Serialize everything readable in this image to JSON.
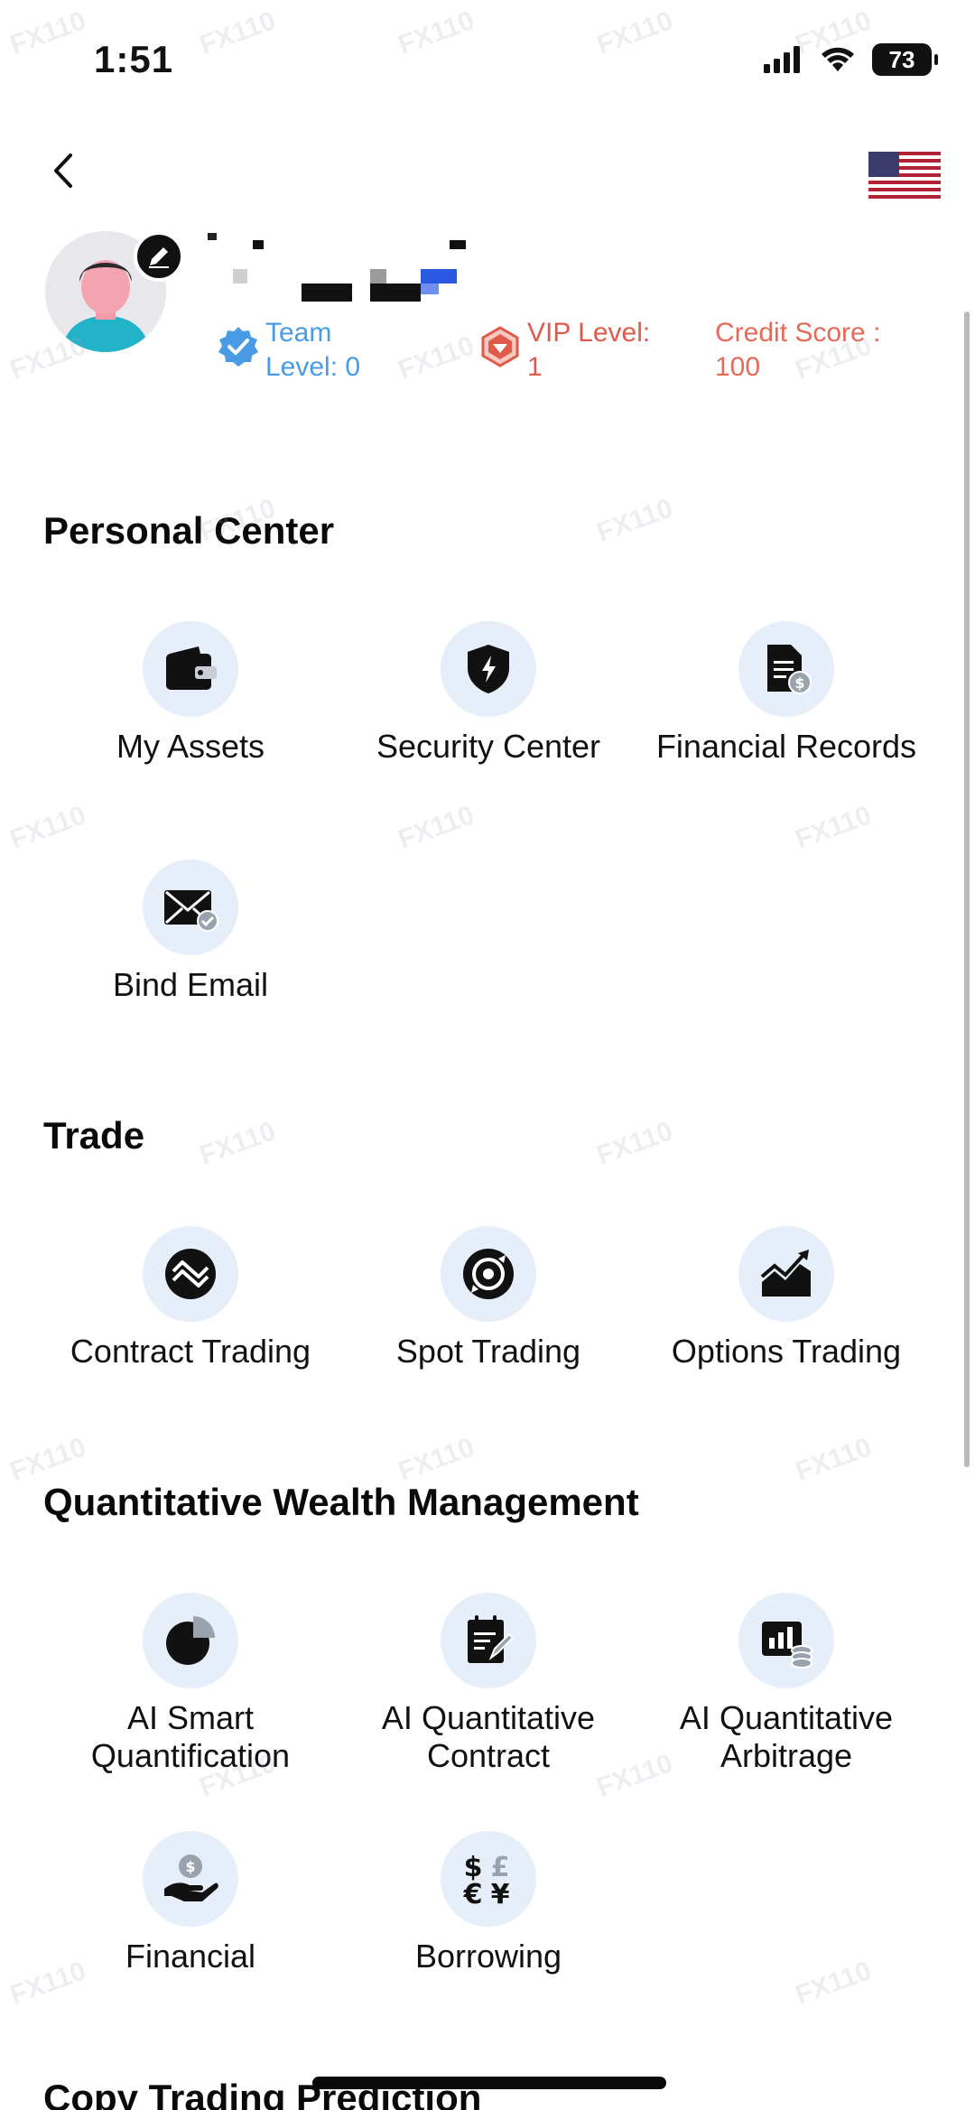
{
  "status_bar": {
    "time": "1:51",
    "battery": "73"
  },
  "profile": {
    "team_label": "Team\nLevel: 0",
    "vip_label": "VIP Level:\n1",
    "credit_label": "Credit Score :\n100"
  },
  "sections": {
    "personal_center": {
      "title": "Personal Center",
      "items": [
        {
          "label": "My Assets",
          "icon": "wallet-icon"
        },
        {
          "label": "Security Center",
          "icon": "shield-icon"
        },
        {
          "label": "Financial Records",
          "icon": "document-dollar-icon"
        },
        {
          "label": "Bind Email",
          "icon": "envelope-check-icon"
        }
      ]
    },
    "trade": {
      "title": "Trade",
      "items": [
        {
          "label": "Contract Trading",
          "icon": "contract-trading-icon"
        },
        {
          "label": "Spot Trading",
          "icon": "spot-trading-icon"
        },
        {
          "label": "Options Trading",
          "icon": "chart-arrow-icon"
        }
      ]
    },
    "quant": {
      "title": "Quantitative Wealth Management",
      "items": [
        {
          "label": "AI Smart\nQuantification",
          "icon": "pie-chart-icon"
        },
        {
          "label": "AI Quantitative\nContract",
          "icon": "notepad-icon"
        },
        {
          "label": "AI Quantitative\nArbitrage",
          "icon": "bar-chart-coins-icon"
        },
        {
          "label": "Financial",
          "icon": "hand-coin-icon"
        },
        {
          "label": "Borrowing",
          "icon": "currency-icon"
        }
      ]
    },
    "copy_trading": {
      "title": "Copy Trading Prediction"
    }
  },
  "colors": {
    "accent_blue": "#4a9be5",
    "vip_red": "#e05a4a",
    "icon_bg": "#e6eef9"
  }
}
